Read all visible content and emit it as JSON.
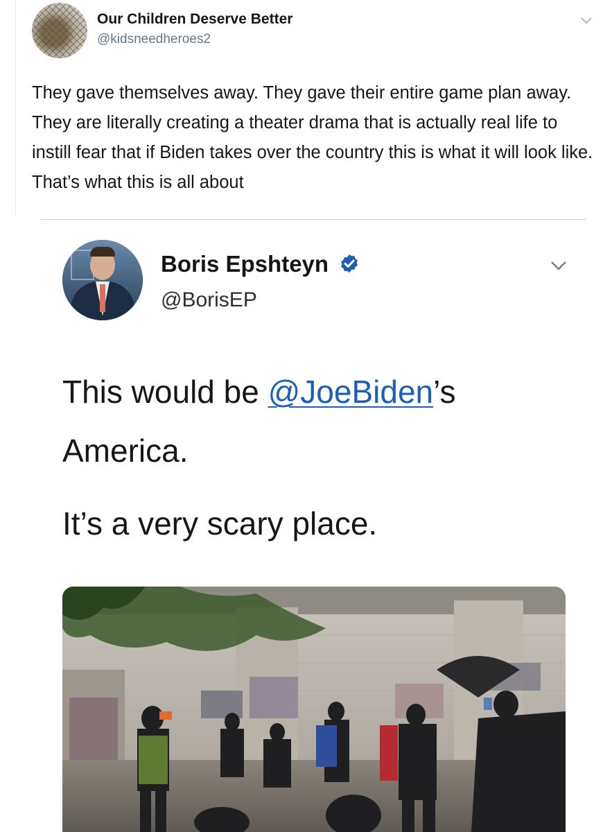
{
  "outer_tweet": {
    "display_name": "Our Children Deserve Better",
    "handle": "@kidsneedheroes2",
    "text": "They gave themselves away. They gave their entire game plan away. They are literally creating a theater drama that is actually real life to instill fear that if Biden takes over the country this is what it will look like. That’s what this is all about",
    "avatar_icon": "profile-photo-fence",
    "menu_icon": "chevron-down-icon"
  },
  "quoted_tweet": {
    "display_name": "Boris Epshteyn",
    "handle": "@BorisEP",
    "verified_icon": "verified-badge-icon",
    "verified_color": "#1d5fb6",
    "menu_icon": "chevron-down-icon",
    "text_prefix": "This would be ",
    "mention": "@JoeBiden",
    "text_suffix": "’s",
    "text_line2": "America.",
    "text_line3": "It’s a very scary place.",
    "mention_color": "#1b5fb6",
    "media_description_icon": "protest-photo"
  },
  "colors": {
    "text_primary": "#14171a",
    "text_secondary": "#657786",
    "divider": "#cdd5dc"
  }
}
